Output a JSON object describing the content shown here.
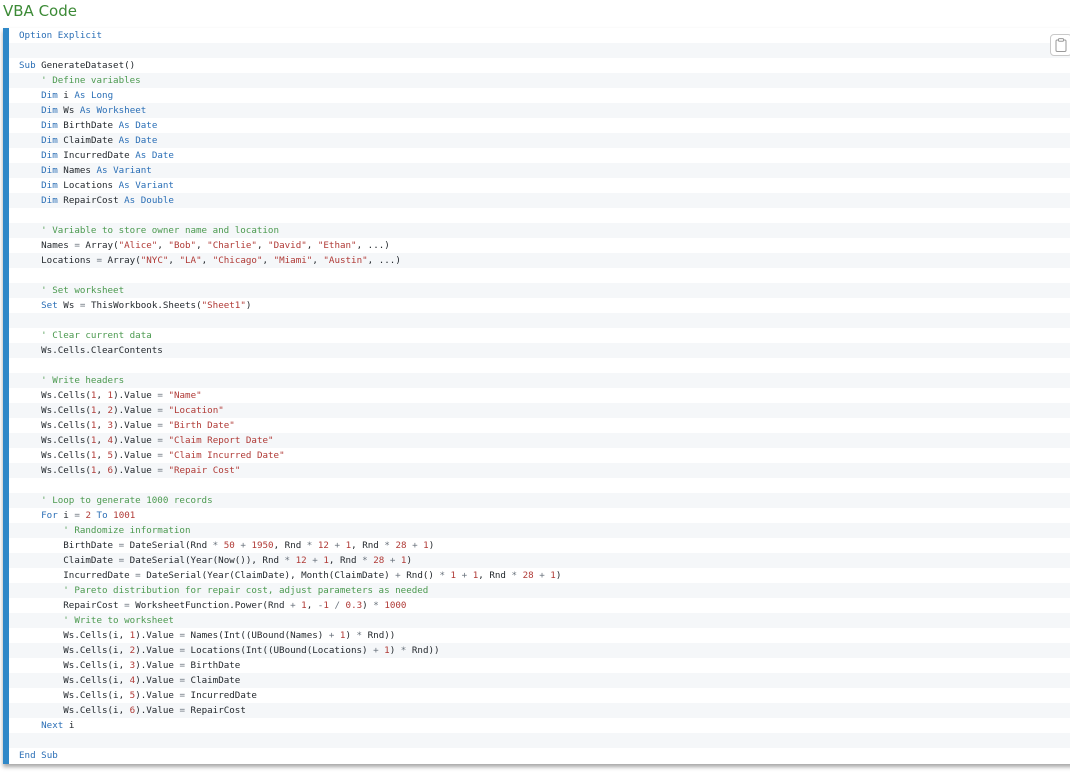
{
  "heading": "VBA Code",
  "colors": {
    "heading": "#3c8a36",
    "accent_bar": "#2f88c8",
    "keyword": "#2b6fb6",
    "comment": "#4c9a50",
    "string": "#b03a36"
  },
  "copy_button_icon": "clipboard-icon",
  "code_lines": [
    "Option Explicit",
    "",
    "Sub GenerateDataset()",
    "    ' Define variables",
    "    Dim i As Long",
    "    Dim Ws As Worksheet",
    "    Dim BirthDate As Date",
    "    Dim ClaimDate As Date",
    "    Dim IncurredDate As Date",
    "    Dim Names As Variant",
    "    Dim Locations As Variant",
    "    Dim RepairCost As Double",
    "",
    "    ' Variable to store owner name and location",
    "    Names = Array(\"Alice\", \"Bob\", \"Charlie\", \"David\", \"Ethan\", ...)",
    "    Locations = Array(\"NYC\", \"LA\", \"Chicago\", \"Miami\", \"Austin\", ...)",
    "",
    "    ' Set worksheet",
    "    Set Ws = ThisWorkbook.Sheets(\"Sheet1\")",
    "",
    "    ' Clear current data",
    "    Ws.Cells.ClearContents",
    "",
    "    ' Write headers",
    "    Ws.Cells(1, 1).Value = \"Name\"",
    "    Ws.Cells(1, 2).Value = \"Location\"",
    "    Ws.Cells(1, 3).Value = \"Birth Date\"",
    "    Ws.Cells(1, 4).Value = \"Claim Report Date\"",
    "    Ws.Cells(1, 5).Value = \"Claim Incurred Date\"",
    "    Ws.Cells(1, 6).Value = \"Repair Cost\"",
    "",
    "    ' Loop to generate 1000 records",
    "    For i = 2 To 1001",
    "        ' Randomize information",
    "        BirthDate = DateSerial(Rnd * 50 + 1950, Rnd * 12 + 1, Rnd * 28 + 1)",
    "        ClaimDate = DateSerial(Year(Now()), Rnd * 12 + 1, Rnd * 28 + 1)",
    "        IncurredDate = DateSerial(Year(ClaimDate), Month(ClaimDate) + Rnd() * 1 + 1, Rnd * 28 + 1)",
    "        ' Pareto distribution for repair cost, adjust parameters as needed",
    "        RepairCost = WorksheetFunction.Power(Rnd + 1, -1 / 0.3) * 1000",
    "        ' Write to worksheet",
    "        Ws.Cells(i, 1).Value = Names(Int((UBound(Names) + 1) * Rnd))",
    "        Ws.Cells(i, 2).Value = Locations(Int((UBound(Locations) + 1) * Rnd))",
    "        Ws.Cells(i, 3).Value = BirthDate",
    "        Ws.Cells(i, 4).Value = ClaimDate",
    "        Ws.Cells(i, 5).Value = IncurredDate",
    "        Ws.Cells(i, 6).Value = RepairCost",
    "    Next i",
    "",
    "End Sub"
  ]
}
